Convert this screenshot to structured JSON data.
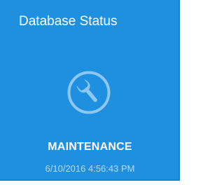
{
  "tile": {
    "title": "Database Status",
    "icon": "wrench-icon",
    "status": "MAINTENANCE",
    "timestamp": "6/10/2016 4:56:43 PM"
  },
  "colors": {
    "tile_background": "#1f90df",
    "icon_stroke": "#8cc8f1",
    "text": "#ffffff",
    "timestamp_text": "#b5dbf6"
  }
}
